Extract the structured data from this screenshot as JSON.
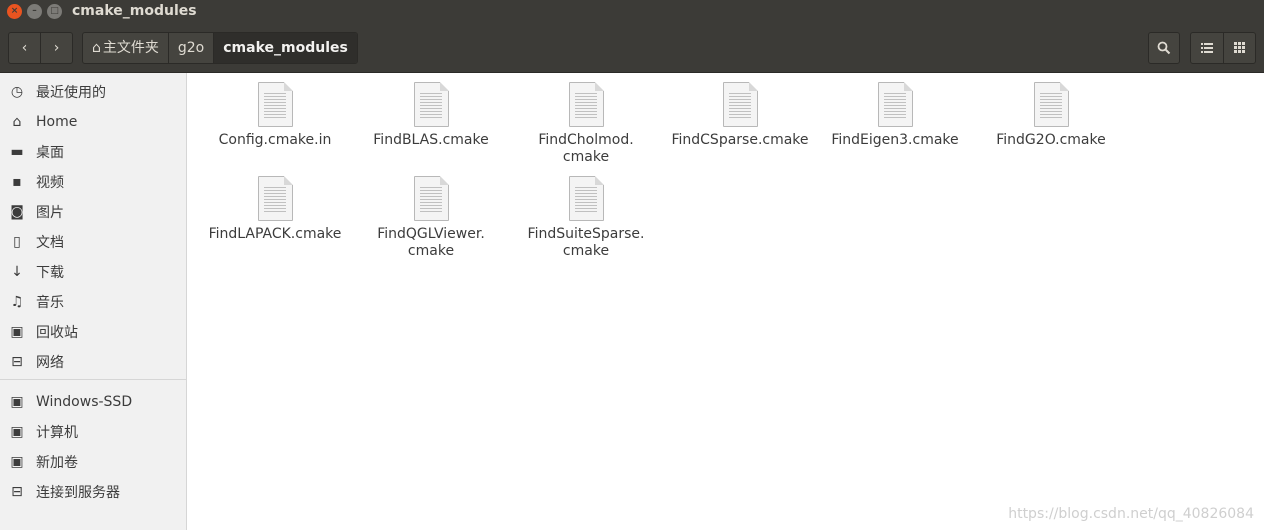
{
  "window": {
    "title": "cmake_modules",
    "close_glyph": "×",
    "min_glyph": "–",
    "max_glyph": "□"
  },
  "toolbar": {
    "back_glyph": "‹",
    "forward_glyph": "›",
    "search_glyph": "🔍",
    "list_view_glyph": "☰",
    "grid_view_glyph": "⋮⋮",
    "breadcrumbs": [
      {
        "label": "主文件夹",
        "icon": "home-icon"
      },
      {
        "label": "g2o"
      },
      {
        "label": "cmake_modules"
      }
    ]
  },
  "sidebar": {
    "items": [
      {
        "label": "最近使用的",
        "icon": "clock-icon",
        "glyph": "◷"
      },
      {
        "label": "Home",
        "icon": "home-icon",
        "glyph": "⌂"
      },
      {
        "label": "桌面",
        "icon": "folder-icon",
        "glyph": "▬"
      },
      {
        "label": "视频",
        "icon": "video-icon",
        "glyph": "▪"
      },
      {
        "label": "图片",
        "icon": "camera-icon",
        "glyph": "◙"
      },
      {
        "label": "文档",
        "icon": "document-icon",
        "glyph": "▯"
      },
      {
        "label": "下载",
        "icon": "download-icon",
        "glyph": "↓"
      },
      {
        "label": "音乐",
        "icon": "music-icon",
        "glyph": "♫"
      },
      {
        "label": "回收站",
        "icon": "trash-icon",
        "glyph": "▣"
      },
      {
        "label": "网络",
        "icon": "network-icon",
        "glyph": "⊟"
      },
      {
        "label": "Windows-SSD",
        "icon": "drive-icon",
        "glyph": "▣"
      },
      {
        "label": "计算机",
        "icon": "computer-icon",
        "glyph": "▣"
      },
      {
        "label": "新加卷",
        "icon": "drive-icon",
        "glyph": "▣"
      },
      {
        "label": "连接到服务器",
        "icon": "server-icon",
        "glyph": "⊟"
      }
    ]
  },
  "files": [
    {
      "name": "Config.cmake.in"
    },
    {
      "name": "FindBLAS.cmake"
    },
    {
      "name": "FindCholmod.\ncmake"
    },
    {
      "name": "FindCSparse.cmake"
    },
    {
      "name": "FindEigen3.cmake"
    },
    {
      "name": "FindG2O.cmake"
    },
    {
      "name": "FindLAPACK.cmake"
    },
    {
      "name": "FindQGLViewer.\ncmake"
    },
    {
      "name": "FindSuiteSparse.\ncmake"
    }
  ],
  "watermark": "https://blog.csdn.net/qq_40826084"
}
